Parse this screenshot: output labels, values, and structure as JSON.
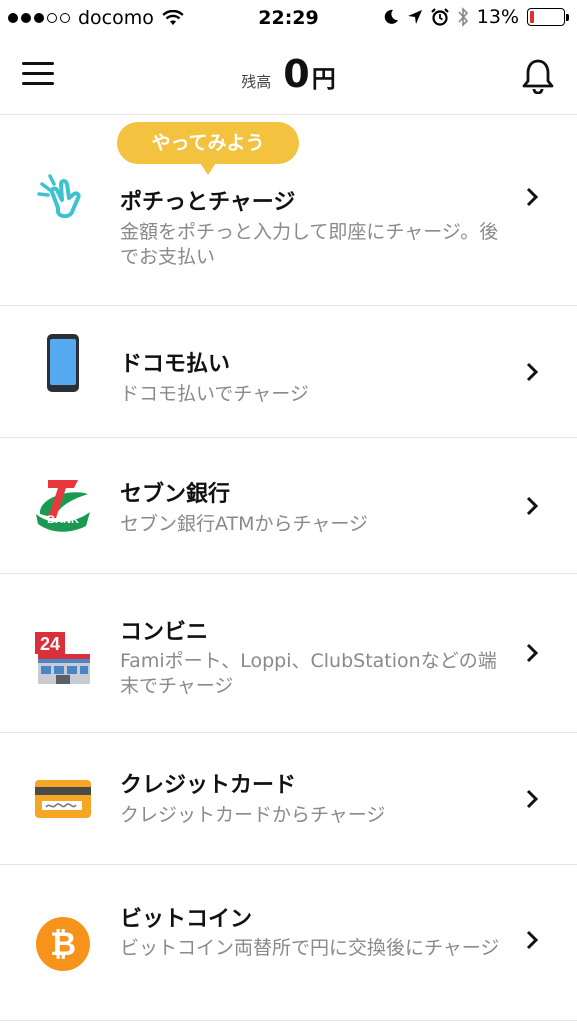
{
  "status_bar": {
    "carrier": "docomo",
    "time": "22:29",
    "battery": "13%",
    "battery_level": 0.13
  },
  "header": {
    "menu_icon": "hamburger-menu-icon",
    "balance_label": "残高",
    "balance_value": "0",
    "balance_unit": "円",
    "bell_icon": "bell-icon"
  },
  "charge_options": [
    {
      "title": "ポチっとチャージ",
      "subtitle": "金額をポチっと入力して即座にチャージ。後でお支払い",
      "icon": "tap-finger-icon",
      "badge": "やってみよう"
    },
    {
      "title": "ドコモ払い",
      "subtitle": "ドコモ払いでチャージ",
      "icon": "smartphone-icon"
    },
    {
      "title": "セブン銀行",
      "subtitle": "セブン銀行ATMからチャージ",
      "icon": "seven-bank-icon",
      "logo_text": "BANK"
    },
    {
      "title": "コンビニ",
      "subtitle": "Famiポート、Loppi、ClubStationなどの端末でチャージ",
      "icon": "convenience-store-icon",
      "logo_text": "24"
    },
    {
      "title": "クレジットカード",
      "subtitle": "クレジットカードからチャージ",
      "icon": "credit-card-icon"
    },
    {
      "title": "ビットコイン",
      "subtitle": "ビットコイン両替所で円に交換後にチャージ",
      "icon": "bitcoin-icon",
      "logo_text": "₿"
    }
  ],
  "colors": {
    "tooltip": "#f3c340",
    "tap_icon": "#3cc3cf",
    "bitcoin": "#f7931a",
    "card": "#f5a623",
    "phone_screen": "#54a9f0"
  }
}
